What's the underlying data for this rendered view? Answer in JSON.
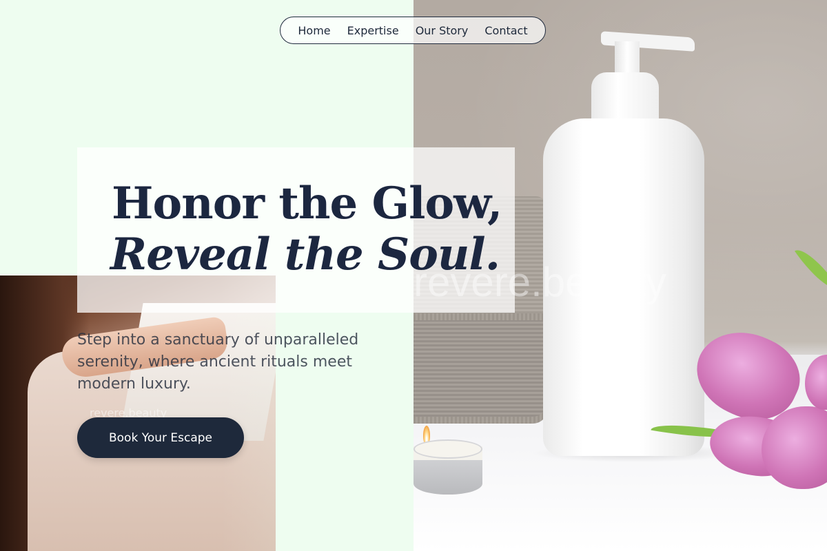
{
  "nav": {
    "items": [
      {
        "label": "Home"
      },
      {
        "label": "Expertise"
      },
      {
        "label": "Our Story"
      },
      {
        "label": "Contact"
      }
    ]
  },
  "hero": {
    "title_line1": "Honor the Glow,",
    "title_line2": "Reveal the Soul.",
    "description": "Step into a sanctuary of unparalleled serenity, where ancient rituals meet modern luxury.",
    "cta_label": "Book Your Escape"
  },
  "watermarks": {
    "large": "revere.beauty",
    "small": "revere.beauty"
  },
  "colors": {
    "background_mint": "#eefdf0",
    "navy": "#1e293b",
    "tulip_pink": "#cf74b6"
  },
  "images": {
    "right_photo": "spa-pump-bottle-towel-candle-tulips",
    "left_photo": "massage-hands-on-back"
  }
}
